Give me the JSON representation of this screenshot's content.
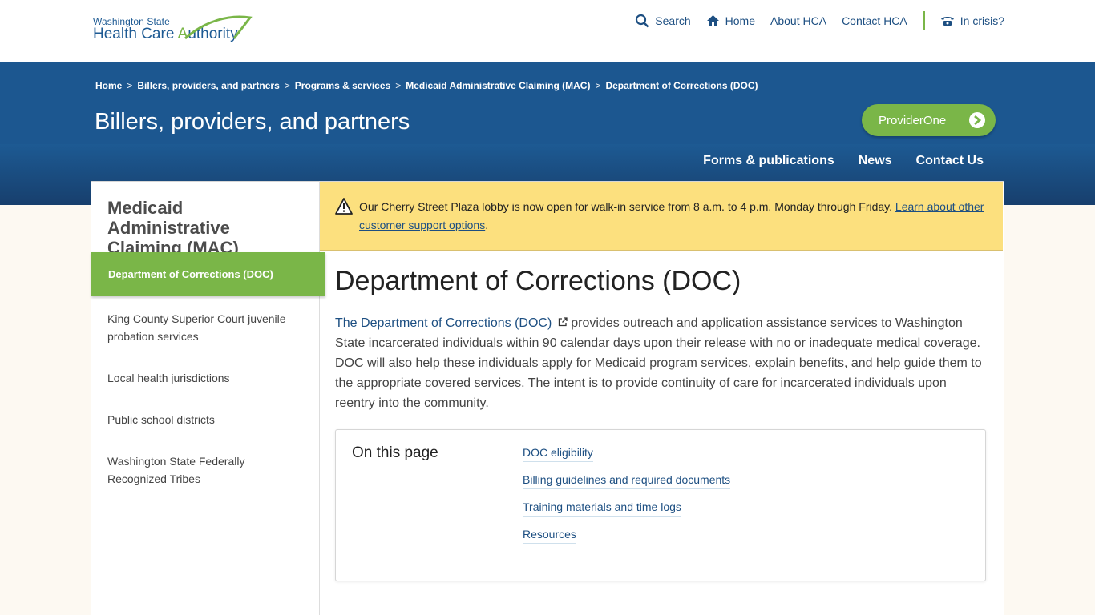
{
  "header": {
    "logo_line1": "Washington State",
    "logo_line2_a": "Health Care ",
    "logo_line2_b": "A",
    "logo_line2_c": "uthority",
    "nav": {
      "search": "Search",
      "home": "Home",
      "about": "About HCA",
      "contact": "Contact HCA",
      "crisis": "In crisis?"
    }
  },
  "breadcrumb": [
    "Home",
    "Billers, providers, and partners",
    "Programs & services",
    "Medicaid Administrative Claiming (MAC)",
    "Department of Corrections (DOC)"
  ],
  "breadcrumb_sep": ">",
  "section_title": "Billers, providers, and partners",
  "providerone_label": "ProviderOne",
  "subnav": [
    "Forms & publications",
    "News",
    "Contact Us"
  ],
  "sidebar": {
    "title": "Medicaid Administrative Claiming (MAC)",
    "active": "Department of Corrections (DOC)",
    "items": [
      "King County Superior Court juvenile probation services",
      "Local health jurisdictions",
      "Public school districts",
      "Washington State Federally Recognized Tribes"
    ]
  },
  "alert": {
    "text": "Our Cherry Street Plaza lobby is now open for walk-in service from 8 a.m. to 4 p.m. Monday through Friday. ",
    "link": "Learn about other customer support options",
    "end": "."
  },
  "page_title": "Department of Corrections (DOC)",
  "intro": {
    "link": "The Department of Corrections (DOC)",
    "text": " provides outreach and application assistance services to Washington State incarcerated individuals within 90 calendar days upon their release with no or inadequate medical coverage. DOC will also help these individuals apply for Medicaid program services, explain benefits, and help guide them to the appropriate covered services. The intent is to provide continuity of care for incarcerated individuals upon reentry into the community."
  },
  "on_this_page": {
    "heading": "On this page",
    "links": [
      "DOC eligibility",
      "Billing guidelines and required documents",
      "Training materials and time logs",
      "Resources"
    ]
  },
  "colors": {
    "brand_blue": "#1c5790",
    "brand_green": "#7ab648",
    "alert_yellow": "#fce07e"
  },
  "icons": [
    "search-icon",
    "home-icon",
    "phone-icon",
    "chevron-right-icon",
    "warning-icon",
    "external-link-icon"
  ]
}
